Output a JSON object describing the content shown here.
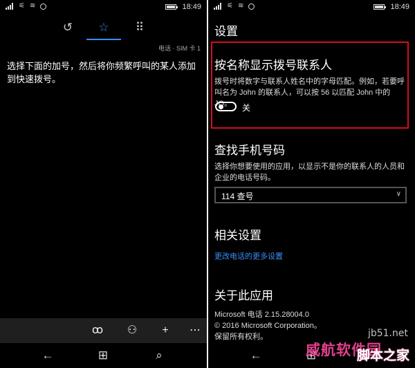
{
  "status": {
    "time": "18:49"
  },
  "left": {
    "tabs": [
      {
        "name": "history",
        "icon": "history-clock-icon"
      },
      {
        "name": "speed-dial",
        "icon": "star-icon"
      },
      {
        "name": "keypad",
        "icon": "keypad-icon"
      }
    ],
    "sim_label": "电话 · SIM 卡 1",
    "hint": "选择下面的加号，然后将你频繁呼叫的某人添加到快速拨号。",
    "appbar": [
      "voicemail-icon",
      "contacts-icon",
      "add-icon",
      "more-icon"
    ]
  },
  "right": {
    "title": "设置",
    "show_by_name": {
      "heading": "按名称显示拨号联系人",
      "desc": "拨号时将数字与联系人姓名中的字母匹配。例如，若要呼叫名为 John 的联系人，可以按 56 以匹配 John 中的 JO。",
      "toggle_label": "关"
    },
    "lookup": {
      "heading": "查找手机号码",
      "desc": "选择你想要使用的应用，以显示不是你的联系人的人员和企业的电话号码。",
      "selected": "114 查号"
    },
    "related": {
      "heading": "相关设置",
      "link": "更改电话的更多设置"
    },
    "about": {
      "heading": "关于此应用",
      "version": "Microsoft 电话 2.15.28004.0",
      "copyright": "© 2016 Microsoft Corporation。",
      "rights": "保留所有权利。"
    }
  },
  "watermark": {
    "site": "jb51.net",
    "logo_top": "威航软件园",
    "logo_bottom": "脚本之家"
  },
  "colors": {
    "accent": "#3a8ef6",
    "highlight_border": "#d3101c"
  }
}
